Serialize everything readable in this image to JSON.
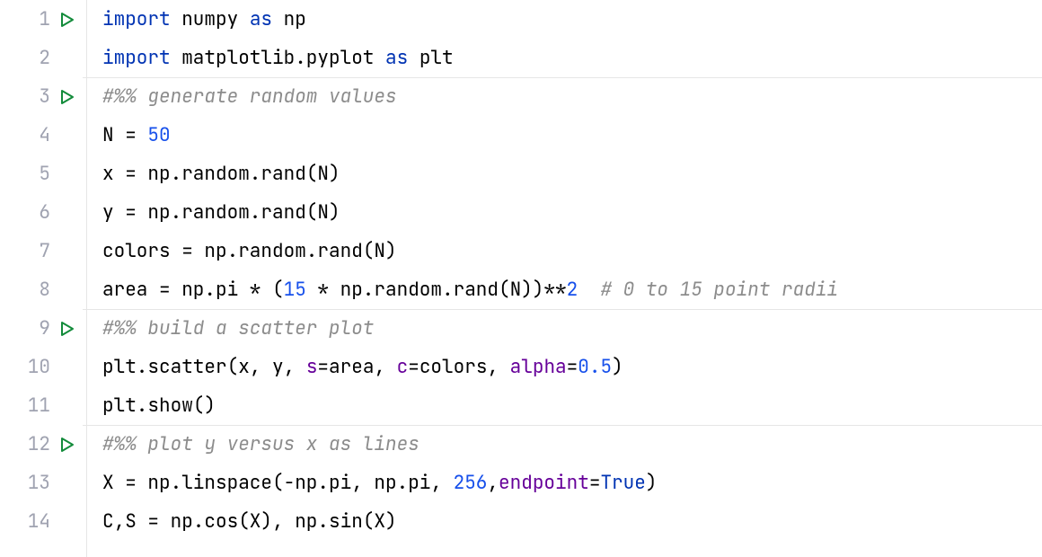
{
  "lines": [
    {
      "num": "1",
      "runnable": true,
      "cellStart": false,
      "tokens": [
        {
          "cls": "tok-kw",
          "text": "import"
        },
        {
          "cls": "tok-text",
          "text": " numpy "
        },
        {
          "cls": "tok-kw",
          "text": "as"
        },
        {
          "cls": "tok-text",
          "text": " np"
        }
      ]
    },
    {
      "num": "2",
      "runnable": false,
      "cellStart": false,
      "tokens": [
        {
          "cls": "tok-kw",
          "text": "import"
        },
        {
          "cls": "tok-text",
          "text": " matplotlib.pyplot "
        },
        {
          "cls": "tok-kw",
          "text": "as"
        },
        {
          "cls": "tok-text",
          "text": " plt"
        }
      ]
    },
    {
      "num": "3",
      "runnable": true,
      "cellStart": true,
      "tokens": [
        {
          "cls": "tok-comment",
          "text": "#%% generate random values"
        }
      ]
    },
    {
      "num": "4",
      "runnable": false,
      "cellStart": false,
      "tokens": [
        {
          "cls": "tok-text",
          "text": "N = "
        },
        {
          "cls": "tok-num",
          "text": "50"
        }
      ]
    },
    {
      "num": "5",
      "runnable": false,
      "cellStart": false,
      "tokens": [
        {
          "cls": "tok-text",
          "text": "x = np.random.rand(N)"
        }
      ]
    },
    {
      "num": "6",
      "runnable": false,
      "cellStart": false,
      "tokens": [
        {
          "cls": "tok-text",
          "text": "y = np.random.rand(N)"
        }
      ]
    },
    {
      "num": "7",
      "runnable": false,
      "cellStart": false,
      "tokens": [
        {
          "cls": "tok-text",
          "text": "colors = np.random.rand(N)"
        }
      ]
    },
    {
      "num": "8",
      "runnable": false,
      "cellStart": false,
      "tokens": [
        {
          "cls": "tok-text",
          "text": "area = np.pi * ("
        },
        {
          "cls": "tok-num",
          "text": "15"
        },
        {
          "cls": "tok-text",
          "text": " * np.random.rand(N))**"
        },
        {
          "cls": "tok-num",
          "text": "2"
        },
        {
          "cls": "tok-text",
          "text": "  "
        },
        {
          "cls": "tok-comment",
          "text": "# 0 to 15 point radii"
        }
      ]
    },
    {
      "num": "9",
      "runnable": true,
      "cellStart": true,
      "tokens": [
        {
          "cls": "tok-comment",
          "text": "#%% build a scatter plot"
        }
      ]
    },
    {
      "num": "10",
      "runnable": false,
      "cellStart": false,
      "tokens": [
        {
          "cls": "tok-text",
          "text": "plt.scatter(x, y, "
        },
        {
          "cls": "tok-kwarg",
          "text": "s"
        },
        {
          "cls": "tok-text",
          "text": "=area, "
        },
        {
          "cls": "tok-kwarg",
          "text": "c"
        },
        {
          "cls": "tok-text",
          "text": "=colors, "
        },
        {
          "cls": "tok-kwarg",
          "text": "alpha"
        },
        {
          "cls": "tok-text",
          "text": "="
        },
        {
          "cls": "tok-num",
          "text": "0.5"
        },
        {
          "cls": "tok-text",
          "text": ")"
        }
      ]
    },
    {
      "num": "11",
      "runnable": false,
      "cellStart": false,
      "tokens": [
        {
          "cls": "tok-text",
          "text": "plt.show()"
        }
      ]
    },
    {
      "num": "12",
      "runnable": true,
      "cellStart": true,
      "tokens": [
        {
          "cls": "tok-comment",
          "text": "#%% plot y versus x as lines"
        }
      ]
    },
    {
      "num": "13",
      "runnable": false,
      "cellStart": false,
      "tokens": [
        {
          "cls": "tok-text",
          "text": "X = np.linspace(-np.pi, np.pi, "
        },
        {
          "cls": "tok-num",
          "text": "256"
        },
        {
          "cls": "tok-text",
          "text": ","
        },
        {
          "cls": "tok-kwarg",
          "text": "endpoint"
        },
        {
          "cls": "tok-text",
          "text": "="
        },
        {
          "cls": "tok-kw",
          "text": "True"
        },
        {
          "cls": "tok-text",
          "text": ")"
        }
      ]
    },
    {
      "num": "14",
      "runnable": false,
      "cellStart": false,
      "tokens": [
        {
          "cls": "tok-text",
          "text": "C,S = np.cos(X), np.sin(X)"
        }
      ]
    }
  ],
  "playIconColor": "#138B3B"
}
